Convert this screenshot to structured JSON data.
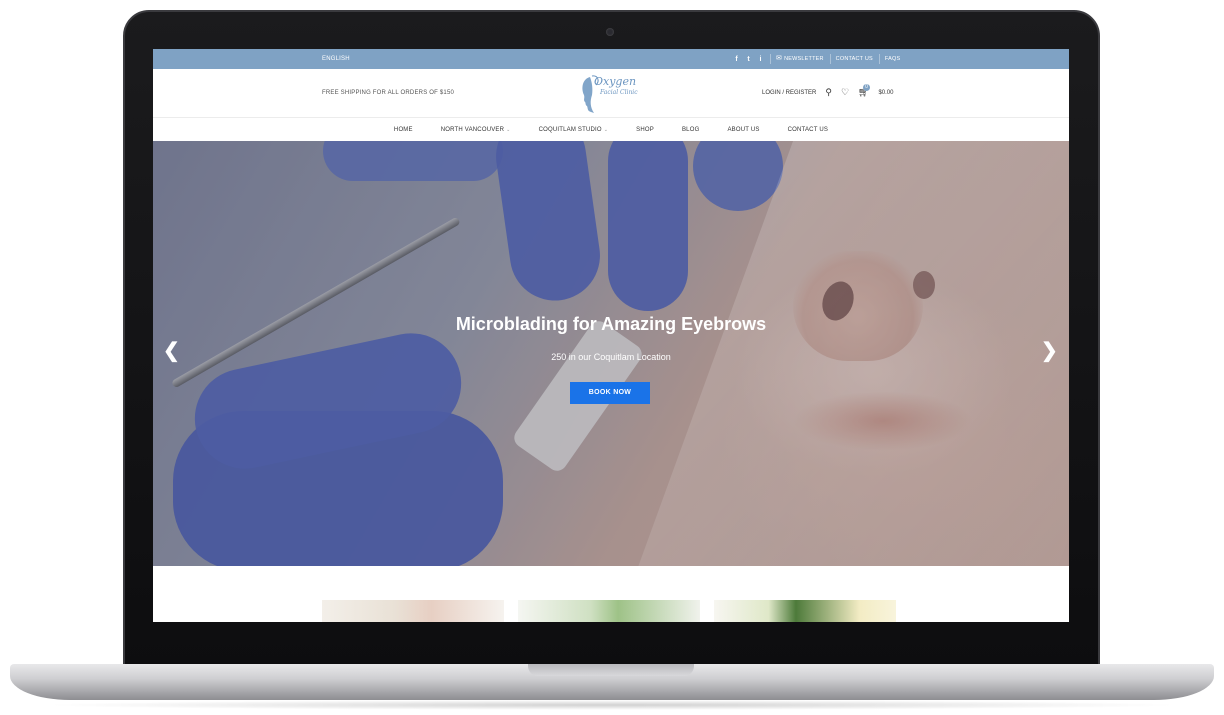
{
  "topbar": {
    "language": "ENGLISH",
    "social": [
      "f",
      "t",
      "i"
    ],
    "newsletter": "NEWSLETTER",
    "contact": "CONTACT US",
    "faqs": "FAQS"
  },
  "header": {
    "shipping_note": "FREE SHIPPING FOR ALL ORDERS OF $150",
    "logo_line1": "Oxygen",
    "logo_line2": "Facial Clinic",
    "login": "LOGIN / REGISTER",
    "cart_count": "0",
    "cart_total": "$0.00"
  },
  "nav": {
    "items": [
      "HOME",
      "NORTH VANCOUVER",
      "COQUITLAM STUDIO",
      "SHOP",
      "BLOG",
      "ABOUT US",
      "CONTACT US"
    ]
  },
  "hero": {
    "title": "Microblading for Amazing Eyebrows",
    "subtitle": "250 in our Coquitlam Location",
    "button": "BOOK NOW",
    "prev": "❮",
    "next": "❯"
  },
  "colors": {
    "topbar": "#7fa2c4",
    "button": "#1a73e8",
    "logo": "#6b95c0"
  }
}
